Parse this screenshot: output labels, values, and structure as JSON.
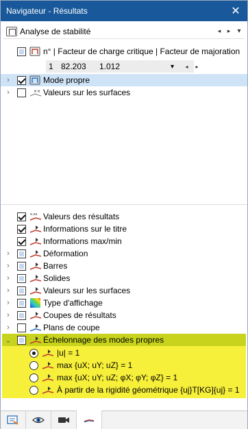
{
  "window": {
    "title": "Navigateur - Résultats",
    "close_glyph": "✕"
  },
  "analysis_dropdown": {
    "value": "Analyse de stabilité",
    "prev_glyph": "◂",
    "next_glyph": "▸",
    "caret_glyph": "▾"
  },
  "mode_table": {
    "header": "n° | Facteur de charge critique | Facteur de majoration",
    "row": {
      "number": "1",
      "critical_factor": "82.203",
      "amplification": "1.012"
    },
    "caret_glyph": "▾",
    "prev_glyph": "◂",
    "next_glyph": "▸"
  },
  "tree_top": [
    {
      "label": "Mode propre",
      "checked": true,
      "icon": "mode-shape-icon",
      "expandable": true,
      "selected": true
    },
    {
      "label": "Valeurs sur les surfaces",
      "checked": false,
      "icon": "surface-values-icon",
      "expandable": true
    }
  ],
  "tree_bottom": [
    {
      "label": "Valeurs des résultats",
      "state": "checked",
      "icon": "result-values-icon",
      "expandable": false
    },
    {
      "label": "Informations sur le titre",
      "state": "checked",
      "icon": "title-info-icon",
      "expandable": false
    },
    {
      "label": "Informations max/min",
      "state": "checked",
      "icon": "maxmin-info-icon",
      "expandable": false
    },
    {
      "label": "Déformation",
      "state": "partial",
      "icon": "deformation-icon",
      "expandable": true
    },
    {
      "label": "Barres",
      "state": "partial",
      "icon": "members-icon",
      "expandable": true
    },
    {
      "label": "Solides",
      "state": "partial",
      "icon": "solids-icon",
      "expandable": true
    },
    {
      "label": "Valeurs sur les surfaces",
      "state": "partial",
      "icon": "surface-values-icon",
      "expandable": true
    },
    {
      "label": "Type d'affichage",
      "state": "partial",
      "icon": "display-type-icon",
      "expandable": true
    },
    {
      "label": "Coupes de résultats",
      "state": "partial",
      "icon": "result-sections-icon",
      "expandable": true
    },
    {
      "label": "Plans de coupe",
      "state": "unchecked",
      "icon": "clipping-planes-icon",
      "expandable": true
    }
  ],
  "scaling": {
    "label": "Échelonnage des modes propres",
    "expand_glyph": "⌄",
    "options": [
      {
        "label": "|u| = 1",
        "selected": true
      },
      {
        "label": "max {uX; uY; uZ} = 1",
        "selected": false
      },
      {
        "label": "max {uX; uY; uZ; φX; φY; φZ} = 1",
        "selected": false
      },
      {
        "label": "À partir de la rigidité géométrique {uj}T[KG]{uj} = 1",
        "selected": false
      }
    ]
  },
  "bottom_tabs": [
    {
      "icon": "navigator-data-icon",
      "active": false
    },
    {
      "icon": "eye-icon",
      "active": false
    },
    {
      "icon": "video-camera-icon",
      "active": false
    },
    {
      "icon": "results-icon",
      "active": true
    }
  ],
  "colors": {
    "titlebar": "#19599b",
    "selection": "#cfe3f7",
    "highlight_yellow": "#f7f03a",
    "highlight_olive": "#c7d31c"
  }
}
